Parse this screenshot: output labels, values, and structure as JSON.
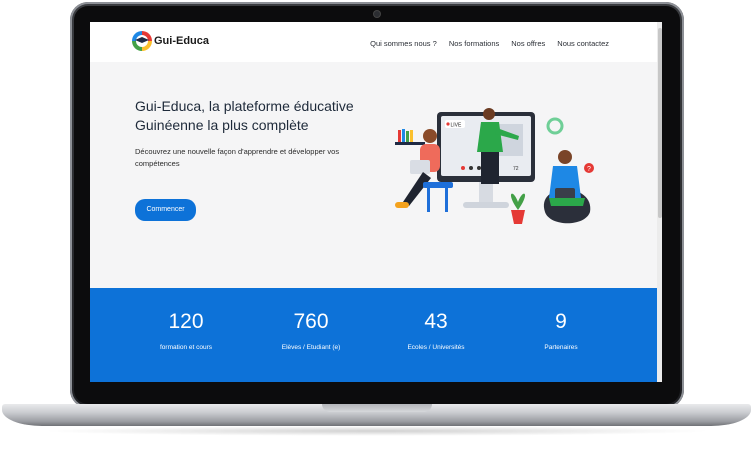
{
  "brand": {
    "name": "Gui-Educa"
  },
  "nav": {
    "items": [
      "Qui sommes nous ?",
      "Nos formations",
      "Nos offres",
      "Nous contactez"
    ]
  },
  "hero": {
    "headline": "Gui-Educa, la plateforme éducative Guinéenne la plus complète",
    "subtitle": "Découvrez une nouvelle façon d'apprendre et développer vos compétences",
    "cta_label": "Commencer",
    "illustration": {
      "live_badge": "LIVE",
      "likes": "72"
    }
  },
  "stats": [
    {
      "value": "120",
      "label": "formation et cours"
    },
    {
      "value": "760",
      "label": "Elèves / Etudiant (e)"
    },
    {
      "value": "43",
      "label": "Ecoles / Universités"
    },
    {
      "value": "9",
      "label": "Partenaires"
    }
  ],
  "colors": {
    "primary": "#0d72d8",
    "nav_bg": "#ffffff",
    "hero_bg": "#f5f5f6"
  }
}
